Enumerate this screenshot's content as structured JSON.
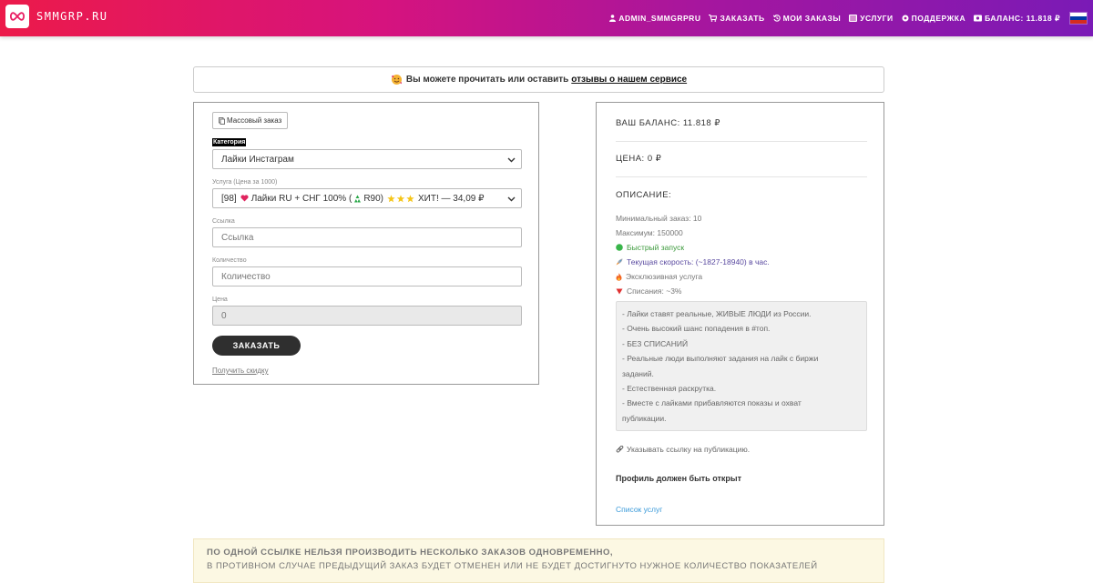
{
  "brand": {
    "name": "SMMGRP.RU",
    "logo_icon": "infinity-icon"
  },
  "nav": {
    "items": [
      {
        "label": "ADMIN_SMMGRPRU",
        "icon": "user-icon"
      },
      {
        "label": "ЗАКАЗАТЬ",
        "icon": "cart-icon"
      },
      {
        "label": "МОИ ЗАКАЗЫ",
        "icon": "history-icon"
      },
      {
        "label": "УСЛУГИ",
        "icon": "list-icon"
      },
      {
        "label": "ПОДДЕРЖКА",
        "icon": "lifebuoy-icon"
      },
      {
        "label": "БАЛАНС: 11.818 ₽",
        "icon": "wallet-icon"
      }
    ],
    "language": "ru",
    "flag_colors": [
      "#ffffff",
      "#0039a6",
      "#d52b1e"
    ]
  },
  "review_bar": {
    "text": "Вы можете прочитать или оставить",
    "link": "отзывы о нашем сервисе"
  },
  "form": {
    "mass_order_label": "Массовый заказ",
    "category_label": "Категория",
    "category_value": "Лайки Инстаграм",
    "service_label": "Услуга (Цена за 1000)",
    "service_value_prefix": "[98]",
    "service_value_main": "Лайки RU + СНГ 100% (",
    "service_value_refill": "R90)",
    "service_value_suffix": "ХИТ! — 34,09 ₽",
    "link_label": "Ссылка",
    "link_placeholder": "Ссылка",
    "quantity_label": "Количество",
    "quantity_placeholder": "Количество",
    "price_label": "Цена",
    "price_value": "0",
    "submit_label": "ЗАКАЗАТЬ",
    "discount_link": "Получить скидку"
  },
  "info": {
    "balance": "ВАШ БАЛАНС: 11.818 ₽",
    "price": "ЦЕНА: 0 ₽",
    "description_title": "ОПИСАНИЕ:",
    "min_order": "Минимальный заказ: 10",
    "max_order": "Максимум: 150000",
    "fast_start": "Быстрый запуск",
    "speed": "Текущая скорость: (~1827-18940) в час.",
    "exclusive": "Эксклюзивная услуга",
    "drop": "Списания: ~3%",
    "description_lines": [
      "- Лайки ставят реальные, ЖИВЫЕ ЛЮДИ из России.",
      "- Очень высокий шанс попадения в #топ.",
      "- БЕЗ СПИСАНИЙ",
      "- Реальные люди выполняют задания на лайк с биржи",
      "заданий.",
      "- Естественная раскрутка.",
      "- Вместе с лайками прибавляются показы и охват",
      "публикации."
    ],
    "link_note": "Указывать ссылку на публикацию.",
    "profile_note": "Профиль должен быть открыт",
    "services_link": "Список услуг"
  },
  "warning": {
    "line1": "ПО ОДНОЙ ССЫЛКЕ НЕЛЬЗЯ ПРОИЗВОДИТЬ НЕСКОЛЬКО ЗАКАЗОВ ОДНОВРЕМЕННО,",
    "line2": "В ПРОТИВНОМ СЛУЧАЕ ПРЕДЫДУЩИЙ ЗАКАЗ БУДЕТ ОТМЕНЕН ИЛИ НЕ БУДЕТ ДОСТИГНУТО НУЖНОЕ КОЛИЧЕСТВО ПОКАЗАТЕЛЕЙ"
  }
}
